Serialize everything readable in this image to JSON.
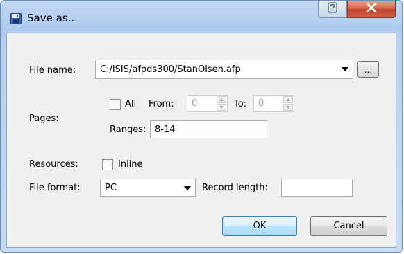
{
  "window": {
    "title": "Save as..."
  },
  "form": {
    "file_name_label": "File name:",
    "file_name_value": "C:/ISIS/afpds300/StanOlsen.afp",
    "browse_label": "...",
    "pages_label": "Pages:",
    "all_label": "All",
    "all_checked": false,
    "from_label": "From:",
    "from_value": "0",
    "to_label": "To:",
    "to_value": "0",
    "ranges_label": "Ranges:",
    "ranges_value": "8-14",
    "resources_label": "Resources:",
    "inline_label": "Inline",
    "inline_checked": false,
    "file_format_label": "File format:",
    "file_format_value": "PC",
    "record_length_label": "Record length:",
    "record_length_value": ""
  },
  "buttons": {
    "ok_label": "OK",
    "cancel_label": "Cancel"
  },
  "icons": {
    "title_icon": "floppy-disk-icon",
    "help_icon": "help-icon",
    "close_icon": "close-icon"
  },
  "colors": {
    "title_gradient_top": "#c3d9f3",
    "close_button": "#c1432a",
    "default_button_border": "#3c7fb1",
    "client_background": "#f0f0f0"
  }
}
